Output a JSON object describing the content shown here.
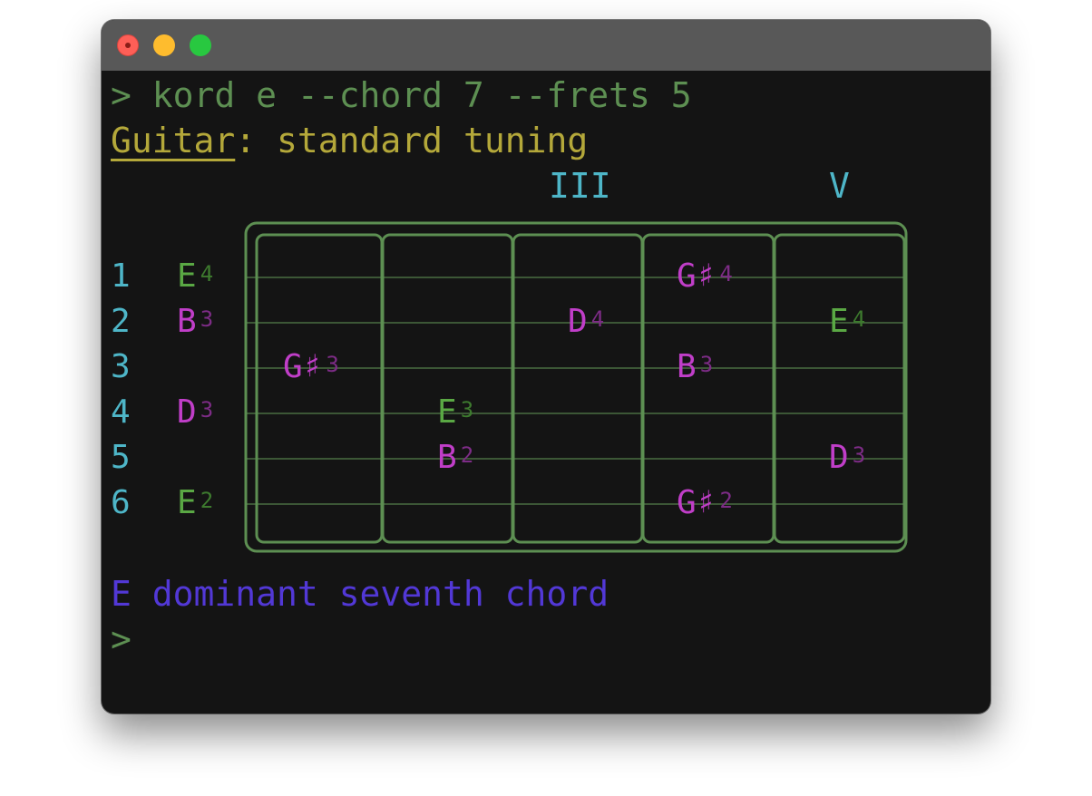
{
  "terminal": {
    "command": "> kord e --chord 7 --frets 5",
    "instrument": "Guitar",
    "tuning_rest": ": standard tuning",
    "chord_name": "E dominant seventh chord",
    "prompt": ">"
  },
  "fret_markers": [
    "III",
    "V"
  ],
  "strings": [
    {
      "number": "1",
      "open": {
        "note": "E",
        "octave": "4",
        "color": "green"
      }
    },
    {
      "number": "2",
      "open": {
        "note": "B",
        "octave": "3",
        "color": "magenta"
      }
    },
    {
      "number": "3",
      "open": null
    },
    {
      "number": "4",
      "open": {
        "note": "D",
        "octave": "3",
        "color": "magenta"
      }
    },
    {
      "number": "5",
      "open": null
    },
    {
      "number": "6",
      "open": {
        "note": "E",
        "octave": "2",
        "color": "green"
      }
    }
  ],
  "fretted_notes": [
    {
      "fret": 1,
      "string": 3,
      "note": "G♯",
      "octave": "3",
      "color": "magenta"
    },
    {
      "fret": 2,
      "string": 4,
      "note": "E",
      "octave": "3",
      "color": "green"
    },
    {
      "fret": 2,
      "string": 5,
      "note": "B",
      "octave": "2",
      "color": "magenta"
    },
    {
      "fret": 3,
      "string": 2,
      "note": "D",
      "octave": "4",
      "color": "magenta"
    },
    {
      "fret": 4,
      "string": 1,
      "note": "G♯",
      "octave": "4",
      "color": "magenta"
    },
    {
      "fret": 4,
      "string": 3,
      "note": "B",
      "octave": "3",
      "color": "magenta"
    },
    {
      "fret": 4,
      "string": 6,
      "note": "G♯",
      "octave": "2",
      "color": "magenta"
    },
    {
      "fret": 5,
      "string": 2,
      "note": "E",
      "octave": "4",
      "color": "green"
    },
    {
      "fret": 5,
      "string": 5,
      "note": "D",
      "octave": "3",
      "color": "magenta"
    }
  ],
  "colors": {
    "background": "#141414",
    "titlebar": "#585858",
    "prompt_green": "#5d8f52",
    "tuning_yellow": "#b4a83a",
    "marker_cyan": "#4eb6c8",
    "note_green": "#5aa844",
    "note_magenta": "#c03ec8",
    "chord_purple": "#5238d6",
    "fretboard": "#5d8f52"
  }
}
